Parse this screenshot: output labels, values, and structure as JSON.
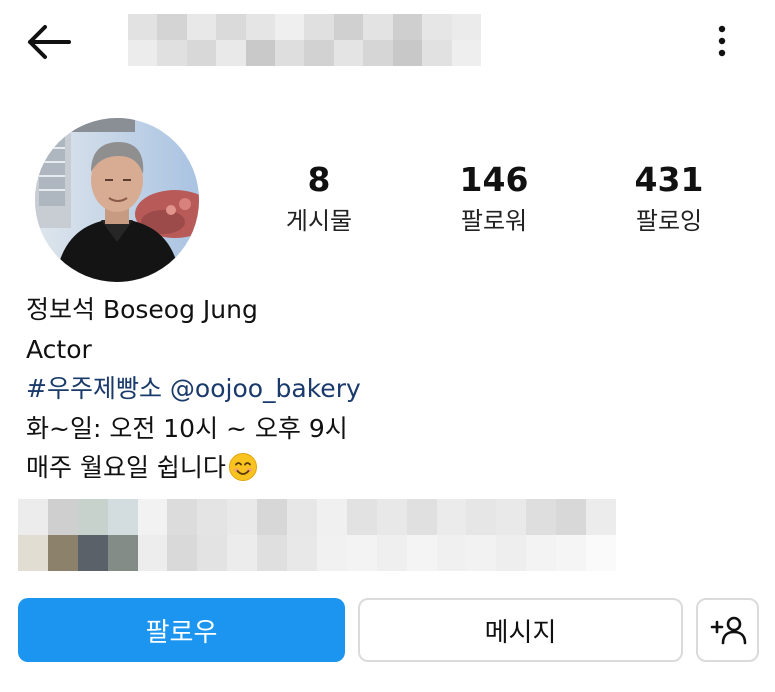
{
  "header": {
    "back_icon": "arrow-left-icon",
    "more_icon": "more-vertical-icon",
    "username_blurred": true
  },
  "profile": {
    "avatar_alt": "profile photo"
  },
  "stats": [
    {
      "value": "8",
      "label": "게시물"
    },
    {
      "value": "146",
      "label": "팔로워"
    },
    {
      "value": "431",
      "label": "팔로잉"
    }
  ],
  "bio": {
    "name": "정보석 Boseog Jung",
    "category": "Actor",
    "hashtag": "#우주제빵소",
    "mention": "@oojoo_bakery",
    "hours": "화~일: 오전 10시 ~ 오후 9시",
    "closed": "매주 월요일 쉽니다",
    "closed_emoji": "smiling-face-icon"
  },
  "actions": {
    "follow_label": "팔로우",
    "message_label": "메시지",
    "add_user_icon": "add-user-icon"
  },
  "colors": {
    "follow_button": "#1b95f0",
    "link": "#1a3a6b",
    "button_border": "#dbdbdb"
  }
}
